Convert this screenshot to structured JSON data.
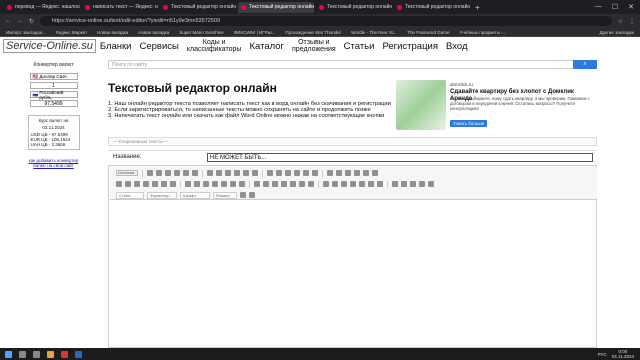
{
  "browser": {
    "tabs": [
      {
        "label": "перевод — Яндекс: нашлось 1",
        "active": false
      },
      {
        "label": "написать текст — Яндекс: на",
        "active": false
      },
      {
        "label": "Текстовый редактор онлайн",
        "active": false
      },
      {
        "label": "Текстовый редактор онлайн",
        "active": true
      },
      {
        "label": "Текстовый редактор онлайн",
        "active": false
      },
      {
        "label": "Текстовый редактор онлайн",
        "active": false
      }
    ],
    "url": "https://service-online.su/text/edit-editor/?yiedit=n51y9e3mn53572509",
    "bookmarks": [
      "Импорт закладок...",
      "Яндекс Маркет",
      "Новая вкладка",
      "Новая вкладка",
      "Super Mario Sunshine",
      "ФИКСИКИ | ИГРЫ...",
      "Прохождение War Thunder",
      "Wordle - The New Yo...",
      "The Password Game",
      "Учебные предметы -..."
    ],
    "bookmarks_right": "Другие закладки"
  },
  "site": {
    "logo": "Service-Online.su",
    "nav": [
      "Бланки",
      "Сервисы",
      "Коды и|классификаторы",
      "Каталог",
      "Отзывы и|предложения",
      "Статьи",
      "Регистрация",
      "Вход"
    ]
  },
  "sidebar": {
    "title": "Конвертер валют",
    "cur1": "Доллар США",
    "amount1": "1",
    "cur2": "Российский рубль",
    "amount2": "97.5499",
    "rates_title": "Курс валют на",
    "rates_date": "03.11.2024",
    "rates": [
      "USD ЦБ - 97.5499",
      "EUR ЦБ - 106.1624",
      "UAH ЦБ - 2.3666"
    ],
    "link": "как добавить конвертер валют на свой сайт"
  },
  "search": {
    "placeholder": "Поиск по сайту"
  },
  "page": {
    "title": "Текстовый редактор онлайн",
    "points": [
      "1. Наш онлайн редактор текста позволяет написать текст как в ворд онлайн без скачивания и регистрации",
      "2. Если зарегистрироваться, то написанные тексты можно сохранять на сайте и продолжить позже",
      "3. Напечатать текст онлайн или скачать как файл Word Online можно нажав на соответствующие кнопки"
    ]
  },
  "ad": {
    "source": "domclick.ru",
    "headline": "Сдавайте квартиру без хлопот с Домклик Аренда",
    "text": "Вы сами выбираете, кому сдать квартиру, а мы проверим. Поможем с договором и передачей ключей. Остались вопросы? Получите консультацию!",
    "button": "Узнать больше"
  },
  "saved_texts": "— Сохраненные тексты —",
  "name_label": "Название:",
  "name_value": "НЕ МОЖЕТ БЫТЬ...",
  "editor": {
    "source_btn": "Источник",
    "style_dd": "Стили",
    "format_dd": "Форматир...",
    "font_dd": "Шрифт",
    "size_dd": "Размер"
  },
  "taskbar": {
    "lang": "РУС",
    "time": "0:00",
    "date": "04.11.2024"
  }
}
